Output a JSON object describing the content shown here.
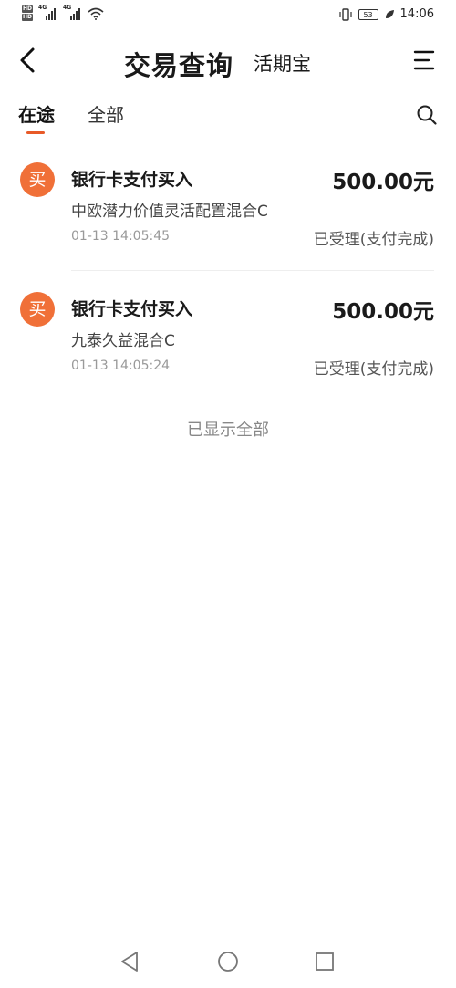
{
  "status_bar": {
    "network_tag1": "4G",
    "network_tag2": "4G",
    "battery": "53",
    "time": "14:06"
  },
  "header": {
    "title": "交易查询",
    "subtitle": "活期宝",
    "icons": {
      "back": "chevron-left-icon",
      "menu": "menu-icon"
    }
  },
  "tabs": {
    "items": [
      {
        "label": "在途"
      },
      {
        "label": "全部"
      }
    ],
    "active": "在途",
    "search_icon": "search-icon",
    "accent_color": "#e85a28"
  },
  "transactions": [
    {
      "badge": "买",
      "title": "银行卡支付买入",
      "amount": "500.00元",
      "fund": "中欧潜力价值灵活配置混合C",
      "time": "01-13 14:05:45",
      "status": "已受理(支付完成)"
    },
    {
      "badge": "买",
      "title": "银行卡支付买入",
      "amount": "500.00元",
      "fund": "九泰久益混合C",
      "time": "01-13 14:05:24",
      "status": "已受理(支付完成)"
    }
  ],
  "footer_text": "已显示全部",
  "badge_color": "#f07038",
  "system_nav": [
    "back-triangle-icon",
    "home-circle-icon",
    "recents-square-icon"
  ]
}
